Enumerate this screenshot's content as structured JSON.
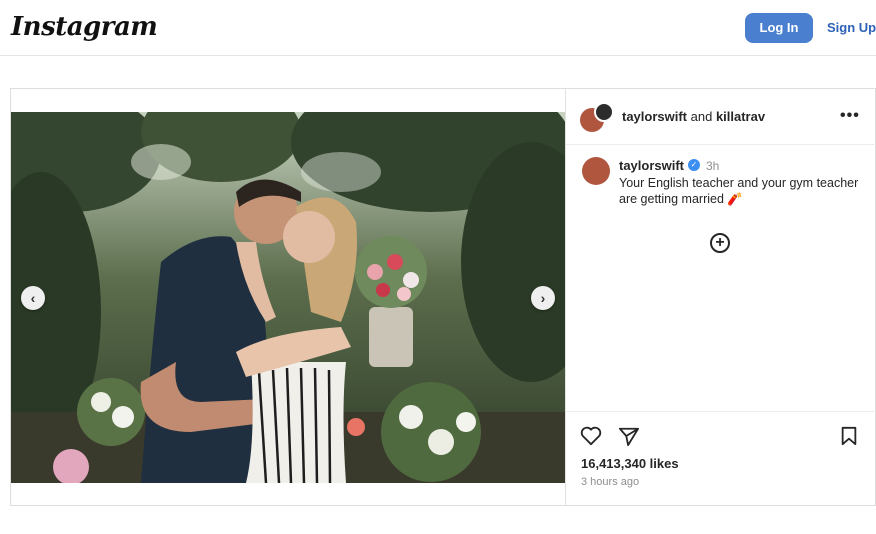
{
  "app": {
    "name": "Instagram"
  },
  "header": {
    "login_label": "Log In",
    "signup_label": "Sign Up"
  },
  "post": {
    "authors": {
      "primary": "taylorswift",
      "joiner": " and ",
      "collaborator": "killatrav"
    },
    "caption": {
      "username": "taylorswift",
      "time": "3h",
      "text": "Your English teacher and your gym teacher are getting married 🧨"
    },
    "likes": "16,413,340 likes",
    "posted_ago": "3 hours ago",
    "icons": {
      "more": "more-options-icon",
      "verified": "verified-badge-icon",
      "add": "add-circle-icon",
      "like": "heart-icon",
      "share": "paper-plane-icon",
      "save": "bookmark-icon",
      "prev": "chevron-left-icon",
      "next": "chevron-right-icon"
    }
  },
  "colors": {
    "login_button": "#4a7fd0",
    "link": "#2d62b7",
    "verified": "#3c8ef0"
  }
}
